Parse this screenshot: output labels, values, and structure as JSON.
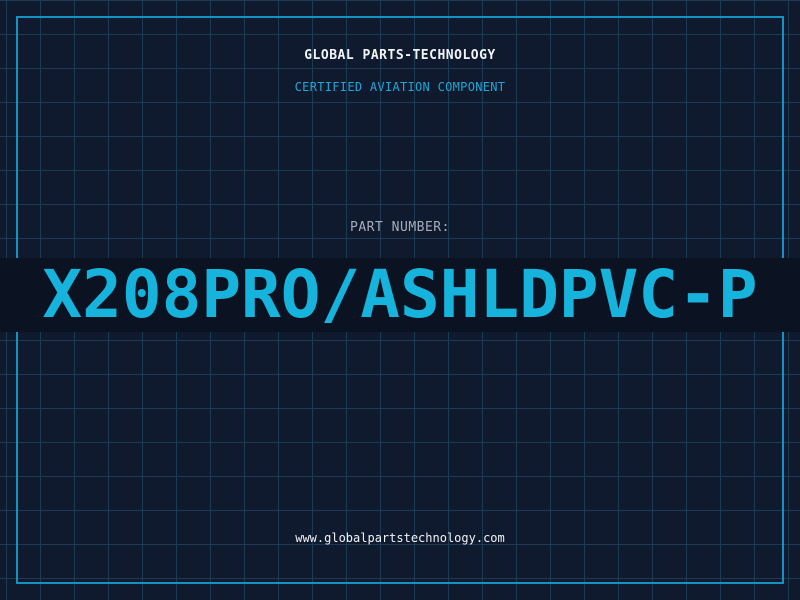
{
  "header": {
    "brand": "GLOBAL PARTS-TECHNOLOGY",
    "tagline": "CERTIFIED AVIATION COMPONENT"
  },
  "part": {
    "label": "PART NUMBER:",
    "number": "X208PRO/ASHLDPVC-P"
  },
  "footer": {
    "url": "www.globalpartstechnology.com"
  },
  "colors": {
    "background": "#101a2e",
    "grid": "#1c3a52",
    "frame": "#1592c2",
    "accent": "#16b4dc",
    "band": "#0b1322"
  }
}
